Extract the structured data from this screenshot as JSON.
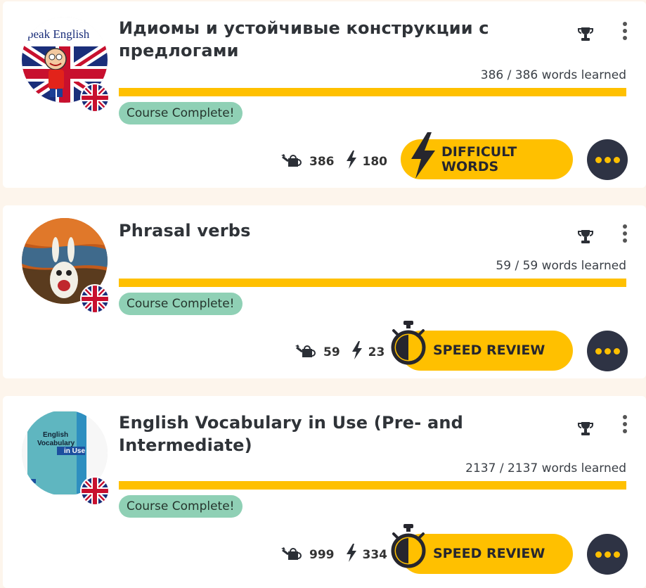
{
  "colors": {
    "accent": "#ffc000",
    "badge": "#8fd0b5",
    "dark_button": "#2e3344",
    "page_bg": "#fdf5ec"
  },
  "courses": [
    {
      "title": "Идиомы и устойчивые конструкции с предлогами",
      "thumbnail_text": "peak English",
      "words_learned": "386 / 386 words learned",
      "progress": 1.0,
      "status_badge": "Course Complete!",
      "watered_count": "386",
      "speed_count": "180",
      "action_label_line1": "DIFFICULT",
      "action_label_line2": "WORDS",
      "action_icon": "lightning-bolt-icon"
    },
    {
      "title": "Phrasal verbs",
      "words_learned": "59 / 59 words learned",
      "progress": 1.0,
      "status_badge": "Course Complete!",
      "watered_count": "59",
      "speed_count": "23",
      "action_label": "SPEED REVIEW",
      "action_icon": "stopwatch-icon"
    },
    {
      "title": "English Vocabulary in Use (Pre- and Intermediate)",
      "thumbnail_text": {
        "line1": "English",
        "line2": "Vocabulary",
        "line3": "in Use"
      },
      "words_learned": "2137 / 2137 words learned",
      "progress": 1.0,
      "status_badge": "Course Complete!",
      "watered_count": "999",
      "speed_count": "334",
      "action_label": "SPEED REVIEW",
      "action_icon": "stopwatch-icon"
    }
  ]
}
